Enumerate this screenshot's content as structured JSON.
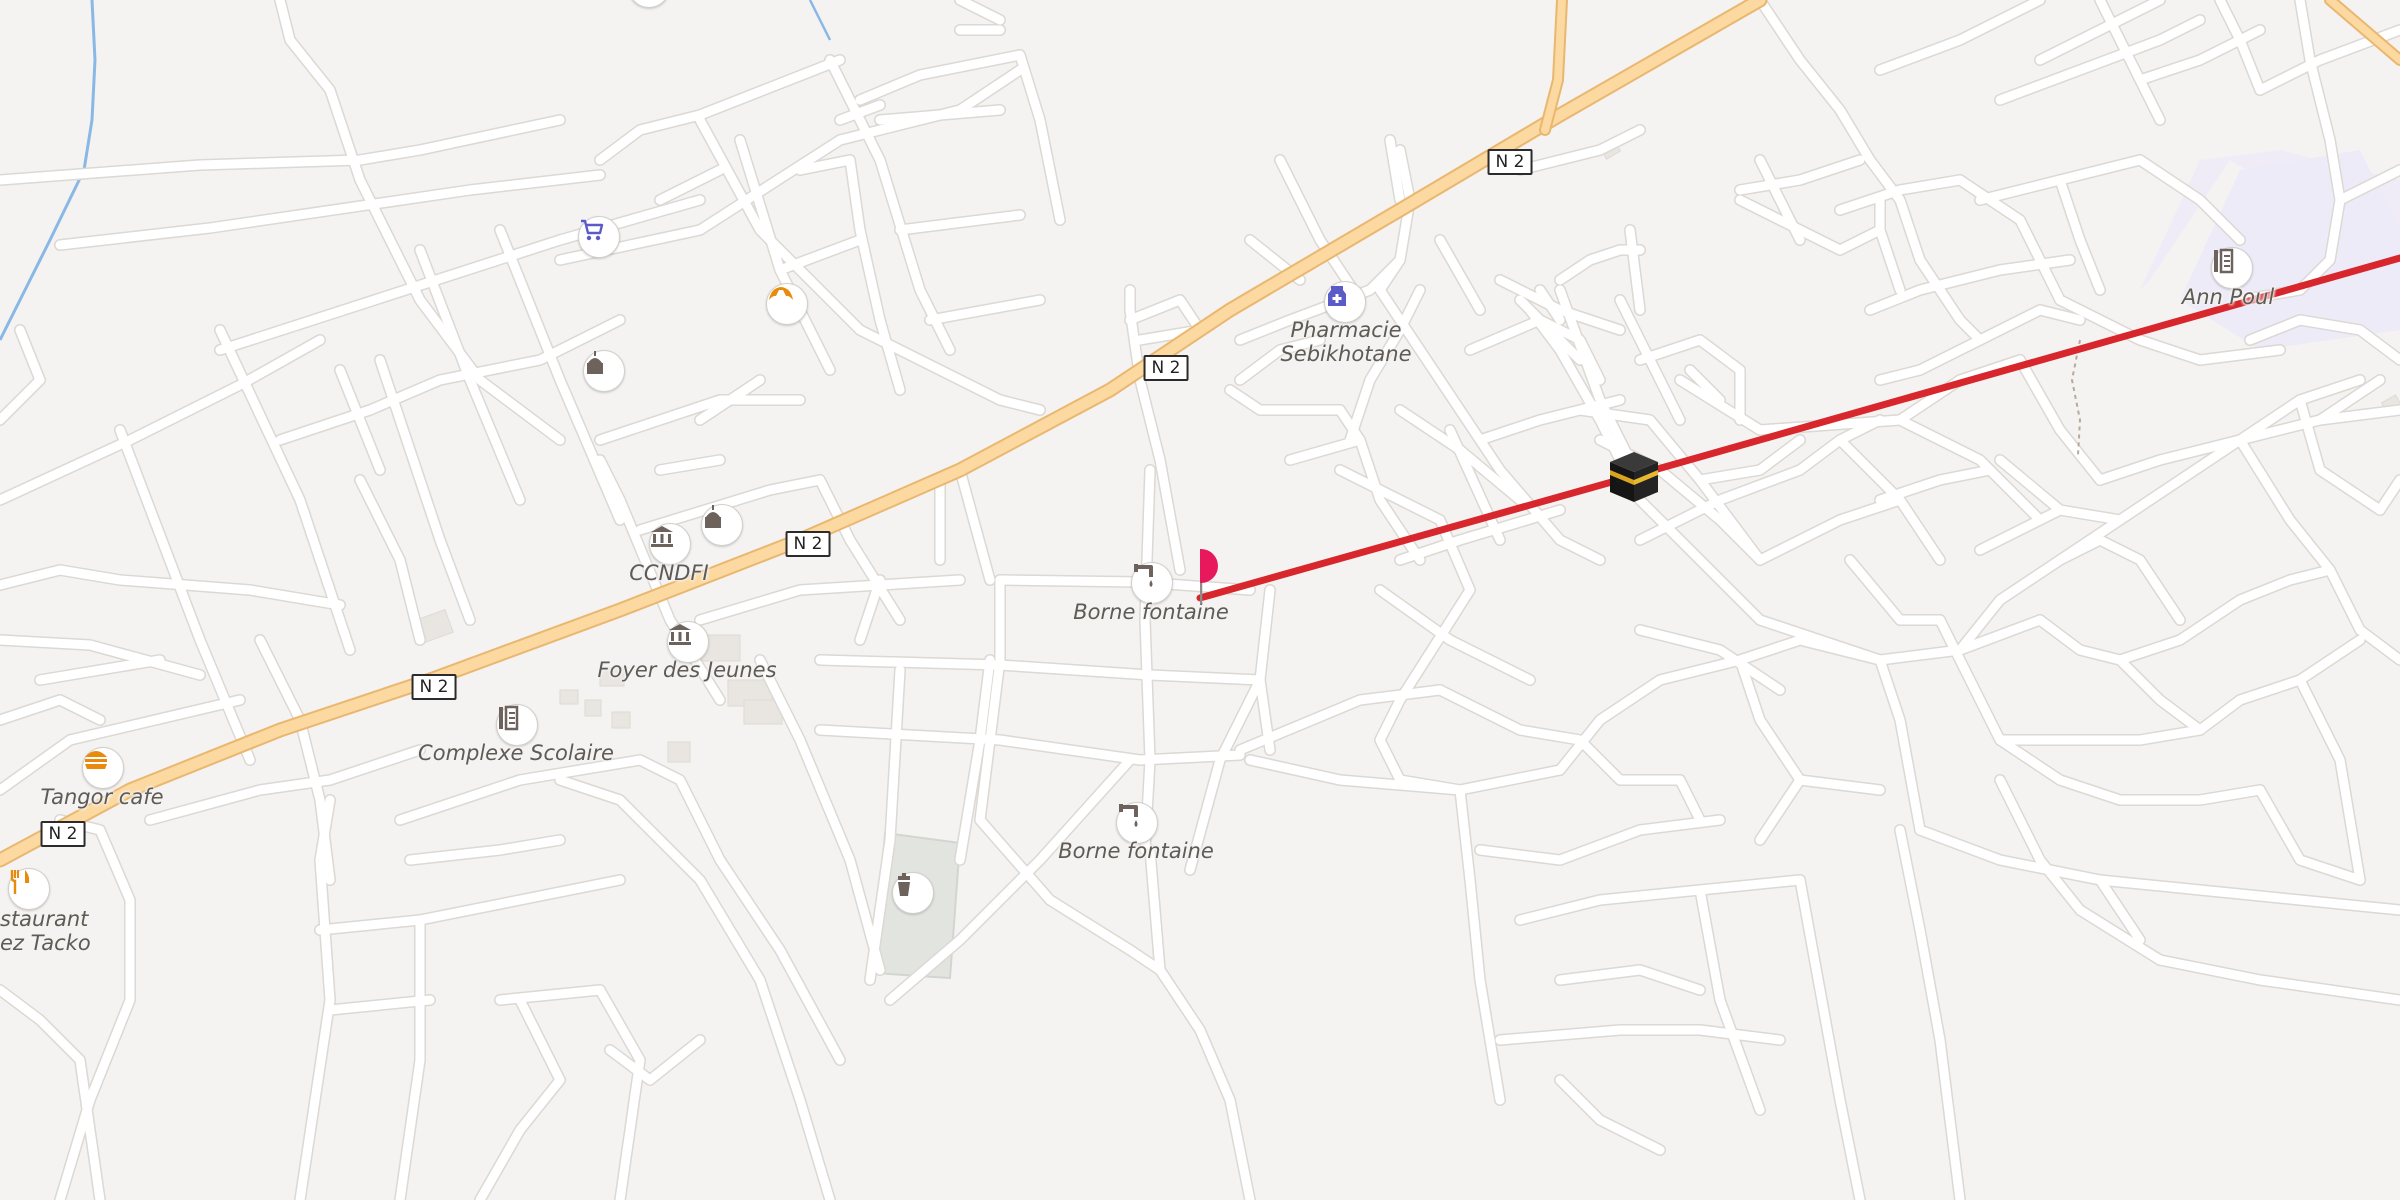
{
  "map": {
    "colors": {
      "background": "#f4f3f1",
      "road": "#ffffff",
      "road_casing": "#dcd8d3",
      "highway": "#fbd9a0",
      "highway_casing": "#eab770",
      "route": "#d7262c",
      "water": "#8ab8e6",
      "park": "#e3e6e0",
      "area": "#f0edfa",
      "pin": "#e8185c"
    },
    "road_shields": [
      {
        "id": "n2-a",
        "label": "N 2"
      },
      {
        "id": "n2-b",
        "label": "N 2"
      },
      {
        "id": "n2-c",
        "label": "N 2"
      },
      {
        "id": "n2-d",
        "label": "N 2"
      },
      {
        "id": "n2-e",
        "label": "N 2"
      }
    ],
    "pois": [
      {
        "id": "shop",
        "icon": "cart-icon",
        "color": "#5b5bc8"
      },
      {
        "id": "bakery",
        "icon": "croissant-icon",
        "color": "#e98a0c"
      },
      {
        "id": "mosque-1",
        "icon": "mosque-icon",
        "color": "#6e635c"
      },
      {
        "id": "mosque-2",
        "icon": "mosque-icon",
        "color": "#6e635c"
      },
      {
        "id": "ccndfi",
        "icon": "museum-icon",
        "color": "#6e635c",
        "label": "CCNDFI"
      },
      {
        "id": "foyer",
        "icon": "museum-icon",
        "color": "#6e635c",
        "label": "Foyer des Jeunes"
      },
      {
        "id": "complexe",
        "icon": "school-icon",
        "color": "#6e635c",
        "label": "Complexe Scolaire"
      },
      {
        "id": "tangor",
        "icon": "burger-icon",
        "color": "#e98a0c",
        "label": "Tangor cafe"
      },
      {
        "id": "restaurant",
        "icon": "fork-knife-icon",
        "color": "#e98a0c",
        "label": "staurant\nez Tacko"
      },
      {
        "id": "fountain-1",
        "icon": "fountain-icon",
        "color": "#6e635c",
        "label": "Borne fontaine"
      },
      {
        "id": "fountain-2",
        "icon": "fountain-icon",
        "color": "#6e635c",
        "label": "Borne fontaine"
      },
      {
        "id": "pharmacy",
        "icon": "pharmacy-icon",
        "color": "#5b5bc8",
        "label": "Pharmacie\nSebikhotane"
      },
      {
        "id": "cemetery",
        "icon": "cemetery-icon",
        "color": "#6e635c"
      },
      {
        "id": "school-east",
        "icon": "school-icon",
        "color": "#6e635c",
        "label": "Ann Poul"
      }
    ],
    "markers": {
      "pin": "location-pin",
      "destination": "kaaba-icon"
    }
  }
}
